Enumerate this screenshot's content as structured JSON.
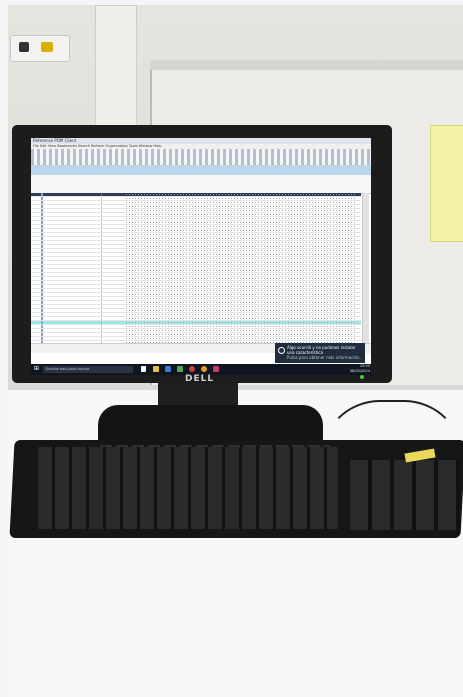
{
  "scene": {
    "monitor_brand": "DELL",
    "app_title": "Reference PDM Client",
    "menu": "File  Edit  View  Bookmarks  Search  Refresh  Organization  Tools  Window  Help",
    "toast_title": "Algo ocurrió y no pudimos instalar una característica",
    "toast_body": "Pulsa para obtener más información.",
    "taskbar_search": "Escribe aquí para buscar",
    "clock_time": "10:55",
    "clock_date": "08/03/2024",
    "colors": {
      "screen_highlight": "#9fe6e8",
      "taskbar": "#0f1621",
      "note": "#f3f3a8"
    }
  }
}
